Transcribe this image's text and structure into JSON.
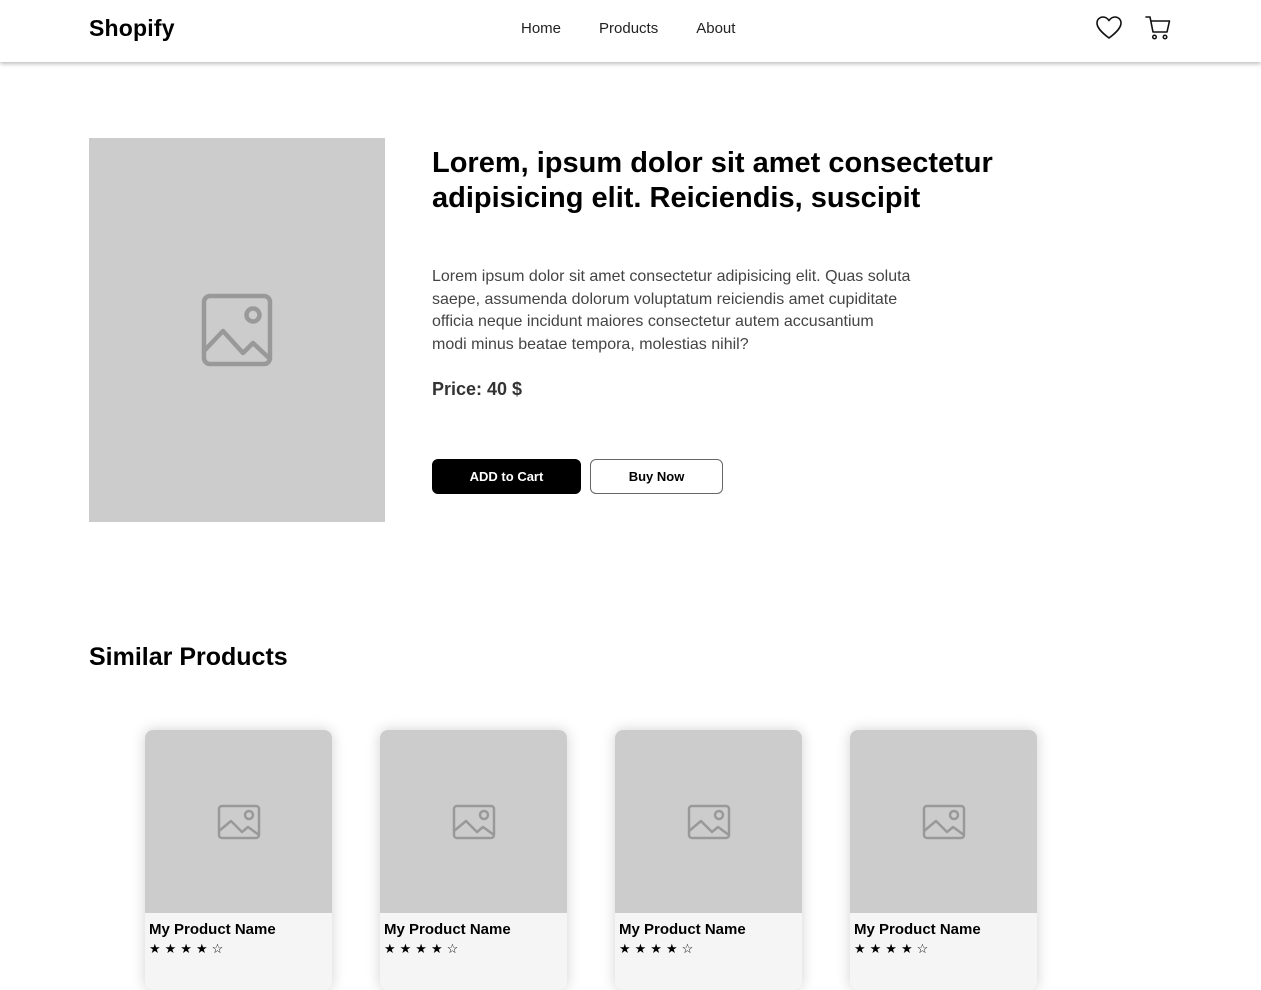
{
  "header": {
    "brand": "Shopify",
    "nav": [
      "Home",
      "Products",
      "About"
    ],
    "icons": [
      "heart-icon",
      "cart-icon"
    ]
  },
  "product": {
    "title": "Lorem, ipsum dolor sit amet consectetur adipisicing elit. Reiciendis, suscipit",
    "description": "Lorem ipsum dolor sit amet consectetur adipisicing elit. Quas soluta saepe, assumenda dolorum voluptatum reiciendis amet cupiditate officia neque incidunt maiores consectetur autem accusantium modi minus beatae tempora, molestias nihil?",
    "price": "Price: 40 $",
    "add_to_cart_label": "ADD to Cart",
    "buy_now_label": "Buy Now",
    "image_icon": "image-placeholder-icon"
  },
  "similar": {
    "title": "Similar Products",
    "items": [
      {
        "name": "My Product Name",
        "stars": "★★★★☆"
      },
      {
        "name": "My Product Name",
        "stars": "★★★★☆"
      },
      {
        "name": "My Product Name",
        "stars": "★★★★☆"
      },
      {
        "name": "My Product Name",
        "stars": "★★★★☆"
      }
    ]
  },
  "colors": {
    "placeholder_bg": "#cccccc",
    "primary_button": "#000000",
    "card_bg": "#f5f5f5"
  }
}
